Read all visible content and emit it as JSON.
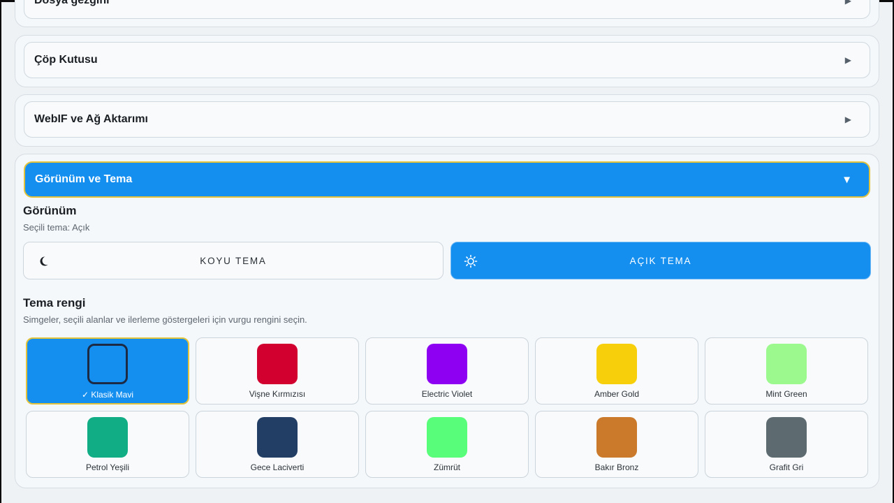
{
  "sections": [
    {
      "title": "Dosya gezgini",
      "arrow": "▶"
    },
    {
      "title": "Çöp Kutusu",
      "arrow": "▶"
    },
    {
      "title": "WebIF ve Ağ Aktarımı",
      "arrow": "▶"
    },
    {
      "title": "Görünüm ve Tema",
      "arrow": "▼"
    }
  ],
  "appearance": {
    "title": "Görünüm",
    "current": "Seçili tema: Açık",
    "dark_label": "KOYU TEMA",
    "light_label": "AÇIK TEMA",
    "selected_mode": "light"
  },
  "accent": {
    "title": "Tema rengi",
    "description": "Simgeler, seçili alanlar ve ilerleme göstergeleri için vurgu rengini seçin.",
    "selected_index": 0,
    "colors": [
      {
        "label": "✓ Klasik Mavi",
        "color": "#148ff0"
      },
      {
        "label": "Vişne Kırmızısı",
        "color": "#d2002f"
      },
      {
        "label": "Electric Violet",
        "color": "#8d00f2"
      },
      {
        "label": "Amber Gold",
        "color": "#f7cf0b"
      },
      {
        "label": "Mint Green",
        "color": "#9bf98d"
      },
      {
        "label": "Petrol Yeşili",
        "color": "#11ae85"
      },
      {
        "label": "Gece Laciverti",
        "color": "#233e65"
      },
      {
        "label": "Zümrüt",
        "color": "#58fd79"
      },
      {
        "label": "Bakır Bronz",
        "color": "#cb7a2b"
      },
      {
        "label": "Grafit Gri",
        "color": "#5d6a70"
      }
    ]
  },
  "colors": {
    "accent": "#148ff0",
    "highlight_border": "#e2c33a"
  }
}
